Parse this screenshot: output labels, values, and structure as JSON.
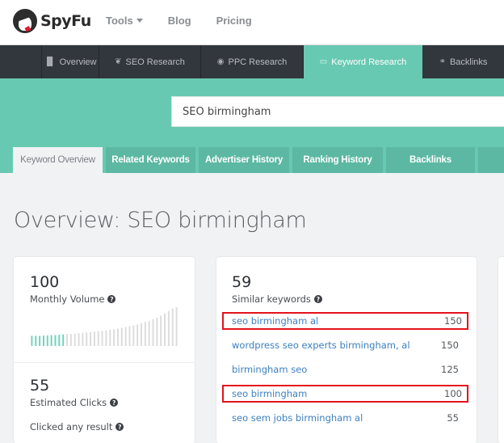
{
  "brand": {
    "name": "SpyFu",
    "accent": "#68c9b2",
    "dark_nav_bg": "#32363d"
  },
  "topnav": {
    "items": [
      {
        "label": "Tools",
        "has_dropdown": true
      },
      {
        "label": "Blog"
      },
      {
        "label": "Pricing"
      }
    ]
  },
  "darknav": {
    "items": [
      {
        "label": "Overview",
        "icon": "bar-chart-icon",
        "glyph": "▐▌"
      },
      {
        "label": "SEO Research",
        "icon": "leaf-icon",
        "glyph": "❦"
      },
      {
        "label": "PPC Research",
        "icon": "target-icon",
        "glyph": "◉"
      },
      {
        "label": "Keyword Research",
        "icon": "keyboard-icon",
        "glyph": "▭",
        "active": true
      },
      {
        "label": "Backlinks",
        "icon": "link-icon",
        "glyph": "⚭"
      }
    ]
  },
  "search": {
    "value": "SEO birmingham"
  },
  "subtabs": [
    {
      "label": "Keyword Overview",
      "active": true
    },
    {
      "label": "Related Keywords"
    },
    {
      "label": "Advertiser History"
    },
    {
      "label": "Ranking History"
    },
    {
      "label": "Backlinks"
    },
    {
      "label": ""
    }
  ],
  "page": {
    "title": "Overview: SEO birmingham"
  },
  "volume_card": {
    "monthly_volume": {
      "value": "100",
      "label": "Monthly Volume",
      "help": "?"
    },
    "volume_history": {
      "highlighted_count": 9,
      "relative_heights": [
        0.26,
        0.26,
        0.26,
        0.27,
        0.27,
        0.28,
        0.28,
        0.29,
        0.3,
        0.31,
        0.31,
        0.32,
        0.33,
        0.34,
        0.35,
        0.36,
        0.37,
        0.38,
        0.39,
        0.4,
        0.42,
        0.43,
        0.45,
        0.47,
        0.49,
        0.51,
        0.53,
        0.56,
        0.59,
        0.62,
        0.65,
        0.69,
        0.73,
        0.78,
        0.84,
        0.9,
        0.96,
        1.0
      ]
    },
    "estimated_clicks": {
      "value": "55",
      "label": "Estimated Clicks",
      "help": "?"
    },
    "clicked_any_result": {
      "label": "Clicked any result",
      "help": "?"
    }
  },
  "similar_card": {
    "count": "59",
    "label": "Similar keywords",
    "help": "?",
    "keywords": [
      {
        "keyword": "seo birmingham al",
        "volume": "150",
        "highlighted": true
      },
      {
        "keyword": "wordpress seo experts birmingham, al",
        "volume": "150"
      },
      {
        "keyword": "birmingham seo",
        "volume": "125"
      },
      {
        "keyword": "seo birmingham",
        "volume": "100",
        "highlighted": true
      },
      {
        "keyword": "seo sem jobs birmingham al",
        "volume": "55"
      }
    ]
  }
}
